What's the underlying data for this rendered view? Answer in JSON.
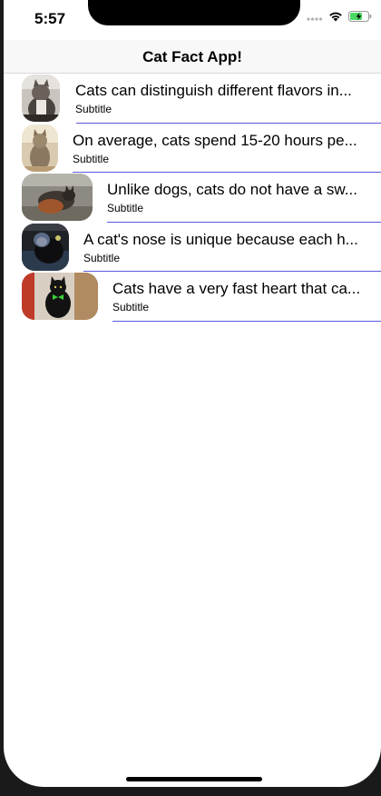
{
  "status_bar": {
    "time": "5:57",
    "icons": [
      "signal-dots-icon",
      "wifi-icon",
      "battery-charging-icon"
    ]
  },
  "nav": {
    "title": "Cat Fact App!"
  },
  "rows": [
    {
      "title": "Cats can distinguish different flavors in...",
      "subtitle": "Subtitle",
      "image_icon": "cat-photo-thumbnail"
    },
    {
      "title": "On average, cats spend 15-20 hours pe...",
      "subtitle": "Subtitle",
      "image_icon": "cat-photo-thumbnail"
    },
    {
      "title": "Unlike dogs, cats do not have a sw...",
      "subtitle": "Subtitle",
      "image_icon": "cat-photo-thumbnail"
    },
    {
      "title": "A cat's nose is unique because each h...",
      "subtitle": "Subtitle",
      "image_icon": "cat-photo-thumbnail"
    },
    {
      "title": "Cats have a very fast heart that ca...",
      "subtitle": "Subtitle",
      "image_icon": "cat-photo-thumbnail"
    }
  ],
  "colors": {
    "separator": "#5a5adc",
    "nav_background": "#f8f8f8"
  }
}
